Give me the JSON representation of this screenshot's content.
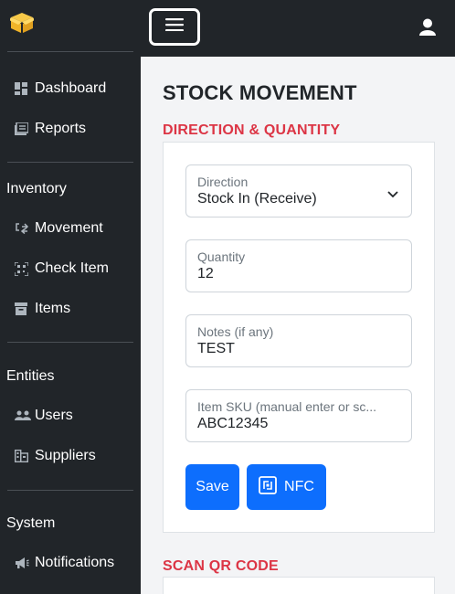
{
  "sidebar": {
    "logo_icon": "box-icon",
    "items_top": [
      {
        "label": "Dashboard",
        "icon": "dashboard-icon"
      },
      {
        "label": "Reports",
        "icon": "reports-icon"
      }
    ],
    "section_inventory": "Inventory",
    "items_inventory": [
      {
        "label": "Movement",
        "icon": "movement-icon"
      },
      {
        "label": "Check Item",
        "icon": "qr-scan-icon"
      },
      {
        "label": "Items",
        "icon": "archive-icon"
      }
    ],
    "section_entities": "Entities",
    "items_entities": [
      {
        "label": "Users",
        "icon": "users-icon"
      },
      {
        "label": "Suppliers",
        "icon": "suppliers-icon"
      }
    ],
    "section_system": "System",
    "items_system": [
      {
        "label": "Notifications",
        "icon": "megaphone-icon"
      }
    ]
  },
  "topbar": {
    "menu_icon": "hamburger-icon",
    "user_icon": "user-icon"
  },
  "main": {
    "title": "STOCK MOVEMENT",
    "section1": "DIRECTION & QUANTITY",
    "section2": "SCAN QR CODE",
    "direction": {
      "label": "Direction",
      "value": "Stock In (Receive)"
    },
    "quantity": {
      "label": "Quantity",
      "value": "12"
    },
    "notes": {
      "label": "Notes (if any)",
      "value": "TEST"
    },
    "sku": {
      "label": "Item SKU (manual enter or sc...",
      "value": "ABC12345"
    },
    "save_label": "Save",
    "nfc_label": "NFC"
  },
  "colors": {
    "sidebar_bg": "#212529",
    "accent_red": "#dc3545",
    "primary_blue": "#0d6efd",
    "page_bg": "#f3f4f6"
  }
}
